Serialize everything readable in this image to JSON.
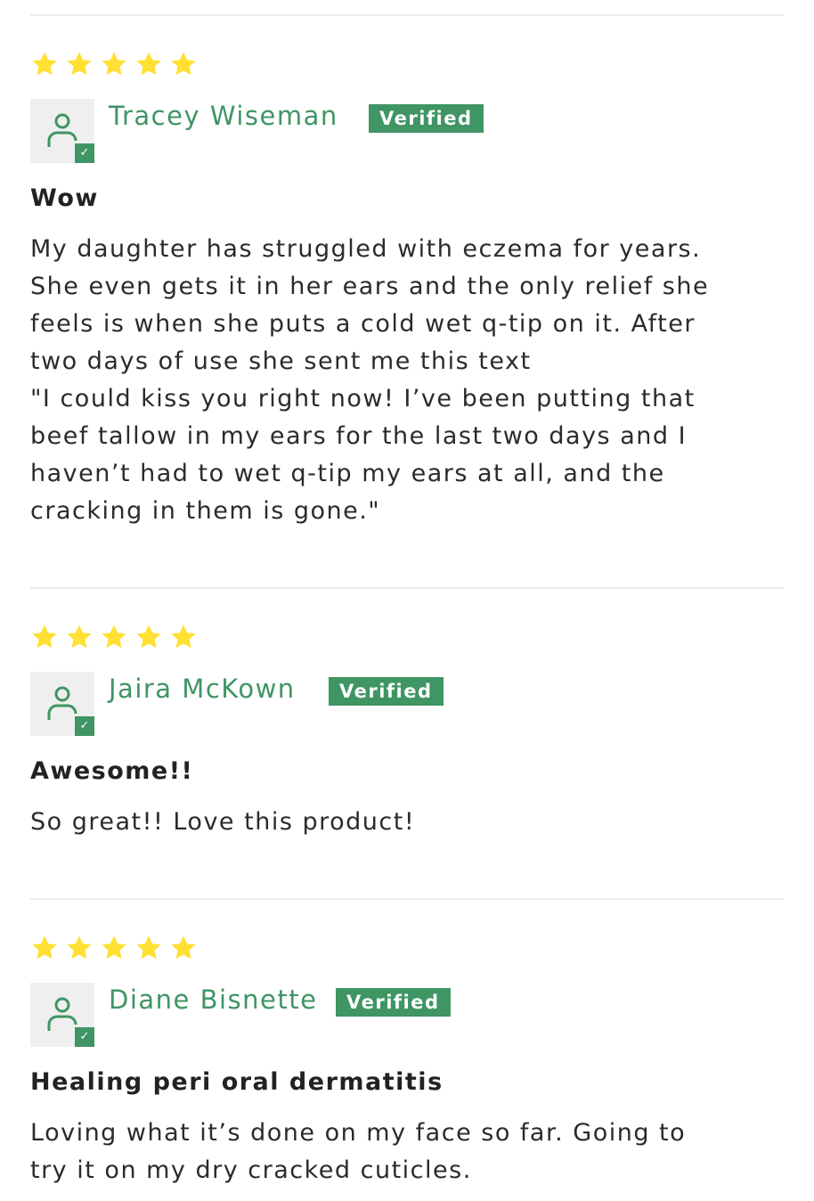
{
  "colors": {
    "accent": "#3f9563",
    "star": "#ffe033",
    "avatar_bg": "#efefef",
    "divider": "#ececec",
    "text": "#2b2b2b"
  },
  "reviews": [
    {
      "rating": 5,
      "author": "Tracey Wiseman",
      "badge": "Verified",
      "title": "Wow",
      "body": "My daughter has struggled with eczema for years.\nShe even gets it in her ears and the only relief she\nfeels is when she puts a cold wet q-tip on it. After\ntwo days of use she sent me this text\n\"I could kiss you right now! I’ve been putting that\nbeef tallow in my ears for the last two days and I\nhaven’t had to wet q-tip my ears at all, and the\ncracking in them is gone.\""
    },
    {
      "rating": 5,
      "author": "Jaira McKown",
      "badge": "Verified",
      "title": "Awesome!!",
      "body": "So great!! Love this product!"
    },
    {
      "rating": 5,
      "author": "Diane Bisnette",
      "badge": "Verified",
      "title": "Healing peri oral dermatitis",
      "body": "Loving what it’s done on my face so far. Going to\ntry it on my dry cracked cuticles."
    }
  ]
}
